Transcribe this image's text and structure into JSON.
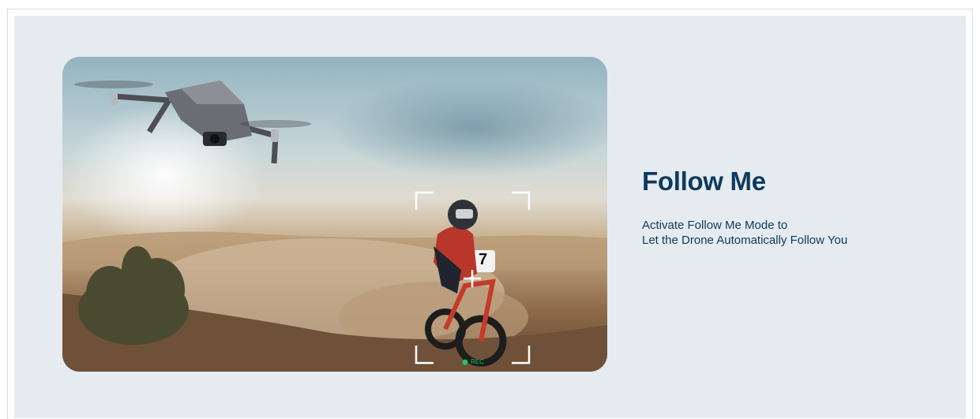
{
  "section": {
    "heading": "Follow Me",
    "description_lines": [
      "Activate Follow Me Mode to",
      "Let the Drone Automatically Follow You"
    ]
  },
  "image": {
    "subject": "drone following a motocross rider in desert",
    "rider_number": "7",
    "rec_indicator": "REC",
    "rec_color": "#22c55e"
  },
  "colors": {
    "heading": "#0e3a5c",
    "panel_background": "#e6ebf0"
  }
}
